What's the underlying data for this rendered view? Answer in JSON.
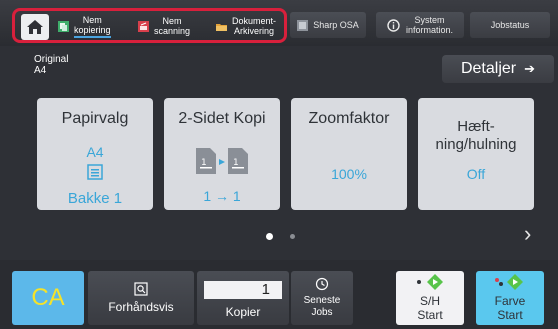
{
  "topbar": {
    "tabs": [
      {
        "label": "Nem kopiering",
        "line1": "Nem",
        "line2": "kopiering"
      },
      {
        "label": "Nem scanning",
        "line1": "Nem",
        "line2": "scanning"
      },
      {
        "label": "Dokument-Arkivering",
        "line1": "Dokument-",
        "line2": "Arkivering"
      }
    ],
    "sharp_osa": "Sharp OSA",
    "system_info_line1": "System",
    "system_info_line2": "information.",
    "jobstatus": "Jobstatus"
  },
  "original": {
    "label": "Original",
    "value": "A4"
  },
  "details_label": "Detaljer",
  "functions": {
    "paper": {
      "title": "Papirvalg",
      "size": "A4",
      "tray": "Bakke 1"
    },
    "duplex": {
      "title": "2-Sidet Kopi",
      "mode": "1 → 1"
    },
    "zoom": {
      "title": "Zoomfaktor",
      "value": "100%"
    },
    "staple": {
      "title_line1": "Hæft-",
      "title_line2": "ning/hulning",
      "value": "Off"
    }
  },
  "pager": {
    "pages": 2,
    "current": 1
  },
  "bottom": {
    "ca": "CA",
    "preview": "Forhåndsvis",
    "copies_value": "1",
    "copies_label": "Kopier",
    "recent_line1": "Seneste",
    "recent_line2": "Jobs",
    "start_bw_line1": "S/H",
    "start_bw_line2": "Start",
    "start_color_line1": "Farve",
    "start_color_line2": "Start"
  },
  "icons": [
    "home-icon",
    "copy-icon",
    "scan-icon",
    "folder-icon",
    "sharp-osa-icon",
    "info-icon",
    "preview-icon",
    "history-icon",
    "start-diamond-icon",
    "chevron-right-icon"
  ],
  "colors": {
    "highlight": "#d8203c",
    "accent_blue": "#3aa6d8",
    "ca_bg": "#5cb8ea",
    "ca_text": "#f5e32a",
    "start_green": "#58c44a",
    "color_start_bg": "#5ac8ee"
  }
}
